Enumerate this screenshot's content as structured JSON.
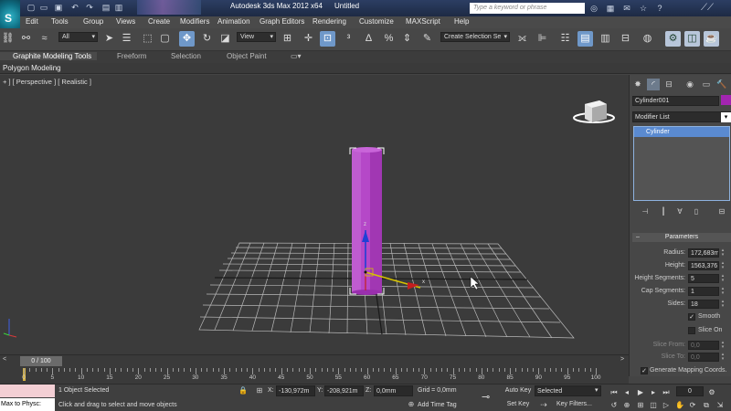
{
  "titlebar": {
    "app_title": "Autodesk 3ds Max  2012 x64",
    "document": "Untitled",
    "search_placeholder": "Type a keyword or phrase",
    "app_button_letter": "S"
  },
  "menu": [
    "Edit",
    "Tools",
    "Group",
    "Views",
    "Create",
    "Modifiers",
    "Animation",
    "Graph Editors",
    "Rendering",
    "Customize",
    "MAXScript",
    "Help"
  ],
  "toolbar": {
    "selection_filter": "All",
    "reference_coord": "View",
    "named_selection": "Create Selection Se"
  },
  "ribbon": {
    "tabs": [
      "Graphite Modeling Tools",
      "Freeform",
      "Selection",
      "Object Paint"
    ],
    "active_panel": "Polygon Modeling"
  },
  "viewport": {
    "label": "+ ] [ Perspective ] [ Realistic ]",
    "object_color": "#b548c8",
    "gizmo_x_color": "#d6c300",
    "gizmo_y_color": "#c41f1f",
    "gizmo_z_color": "#1f3fd6",
    "gizmo_x_label": "x",
    "gizmo_z_label": "z"
  },
  "command_panel": {
    "object_name": "Cylinder001",
    "object_color": "#a325b1",
    "modifier_list": "Modifier List",
    "stack": [
      "Cylinder"
    ],
    "rollout_title": "Parameters",
    "params": [
      {
        "label": "Radius:",
        "value": "172,683m"
      },
      {
        "label": "Height:",
        "value": "1563,376"
      },
      {
        "label": "Height Segments:",
        "value": "5"
      },
      {
        "label": "Cap Segments:",
        "value": "1"
      },
      {
        "label": "Sides:",
        "value": "18"
      }
    ],
    "smooth_label": "Smooth",
    "smooth_checked": true,
    "slice_on_label": "Slice On",
    "slice_on_checked": false,
    "slice_from_label": "Slice From:",
    "slice_from_value": "0,0",
    "slice_to_label": "Slice To:",
    "slice_to_value": "0,0",
    "gen_mapping_label": "Generate Mapping Coords.",
    "gen_mapping_checked": true
  },
  "timeline": {
    "frame_display": "0 / 100",
    "ticks": [
      "0",
      "5",
      "10",
      "15",
      "20",
      "25",
      "30",
      "35",
      "40",
      "45",
      "50",
      "55",
      "60",
      "65",
      "70",
      "75",
      "80",
      "85",
      "90",
      "95",
      "100"
    ]
  },
  "status": {
    "maxscript_output": "Max to Physc:",
    "selection_text": "1 Object Selected",
    "prompt_text": "Click and drag to select and move objects",
    "x_label": "X:",
    "x_value": "-130,972m",
    "y_label": "Y:",
    "y_value": "-208,921m",
    "z_label": "Z:",
    "z_value": "0,0mm",
    "grid_text": "Grid = 0,0mm",
    "add_time_tag": "Add Time Tag",
    "auto_key": "Auto Key",
    "set_key": "Set Key",
    "key_mode_selected": "Selected",
    "key_filters": "Key Filters...",
    "current_frame": "0"
  }
}
